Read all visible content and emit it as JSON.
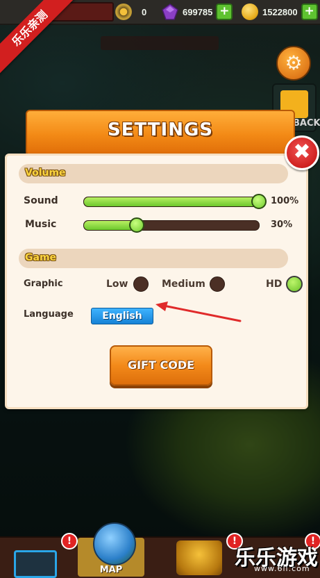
{
  "corner_ribbon": "乐乐亲测",
  "topbar": {
    "resources": [
      {
        "name": "medal",
        "value": "0",
        "icon": "medal-icon"
      },
      {
        "name": "gem",
        "value": "699785",
        "icon": "gem-icon"
      },
      {
        "name": "coin",
        "value": "1522800",
        "icon": "coin-icon"
      }
    ],
    "plus": "+"
  },
  "side": {
    "back_label": "BACK"
  },
  "settings": {
    "title": "SETTINGS",
    "close": "✖",
    "volume_header": "Volume",
    "sound": {
      "label": "Sound",
      "value_text": "100%",
      "level": 1.0
    },
    "music": {
      "label": "Music",
      "value_text": "30%",
      "level": 0.3
    },
    "game_header": "Game",
    "graphic": {
      "label": "Graphic",
      "options": [
        "Low",
        "Medium",
        "HD"
      ],
      "selected": "HD"
    },
    "language": {
      "label": "Language",
      "value": "English"
    },
    "gift_code": "GIFT CODE"
  },
  "bottom_nav": {
    "map_label": "MAP",
    "alert": "!"
  },
  "watermark": {
    "main": "乐乐游戏",
    "sub": "www.6ll.com"
  },
  "colors": {
    "accent_orange": "#f38a16",
    "slider_green": "#6cc72c",
    "close_red": "#cf2020",
    "lang_blue": "#1682d6"
  }
}
